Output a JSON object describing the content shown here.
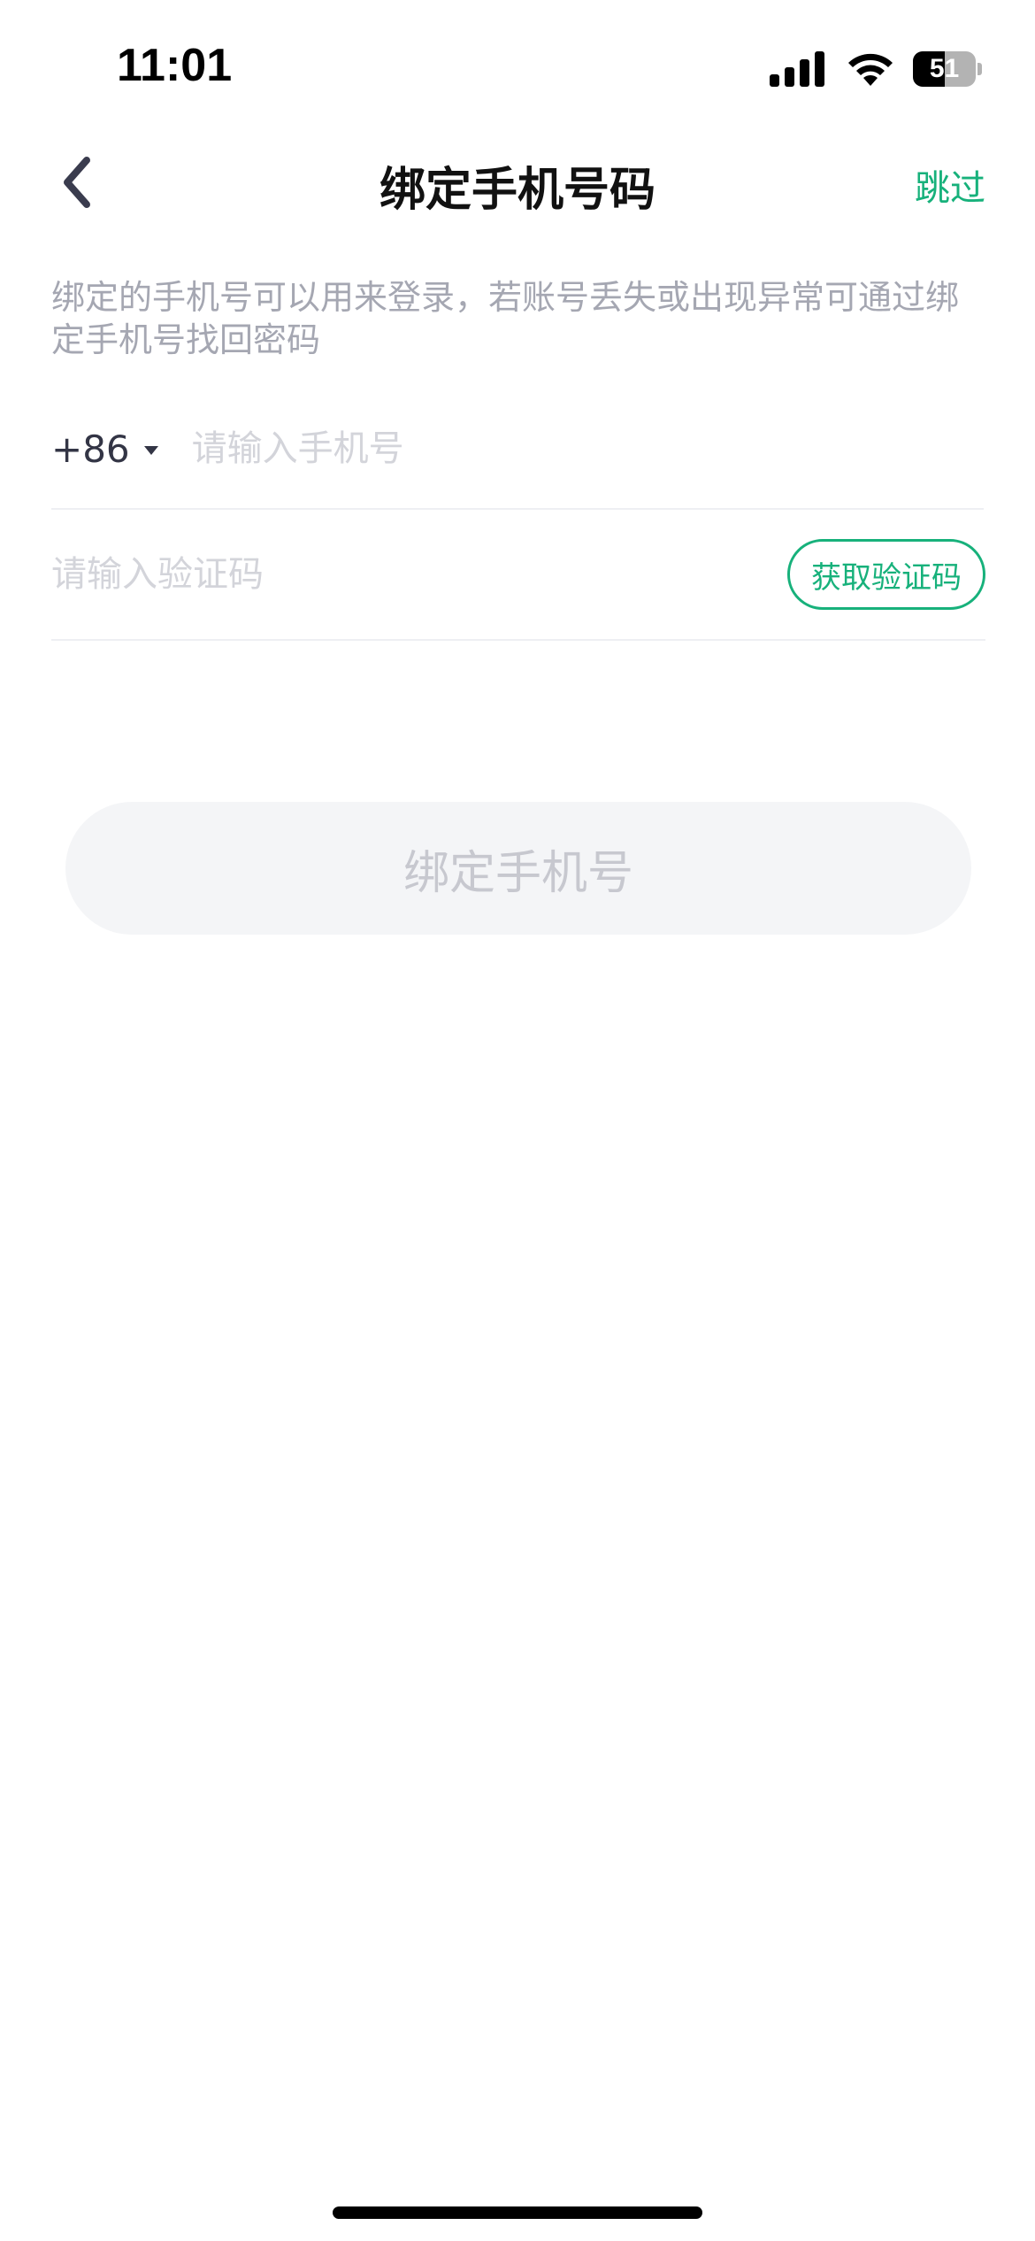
{
  "status_bar": {
    "time": "11:01",
    "battery_level": "51",
    "icons": [
      "signal-icon",
      "wifi-icon",
      "battery-icon"
    ]
  },
  "nav": {
    "back_icon": "chevron-left-icon",
    "title": "绑定手机号码",
    "skip_label": "跳过"
  },
  "description": "绑定的手机号可以用来登录，若账号丢失或出现异常可通过绑定手机号找回密码",
  "phone_field": {
    "country_code": "+86",
    "caret_icon": "caret-down-icon",
    "placeholder": "请输入手机号",
    "value": ""
  },
  "code_field": {
    "placeholder": "请输入验证码",
    "value": "",
    "get_code_label": "获取验证码"
  },
  "bind_button_label": "绑定手机号",
  "colors": {
    "accent": "#17b17b",
    "title": "#111111",
    "hint": "#a5a7b2",
    "placeholder": "#d3d4da",
    "button_bg": "#f4f5f7",
    "button_text": "#c7c8cf"
  }
}
